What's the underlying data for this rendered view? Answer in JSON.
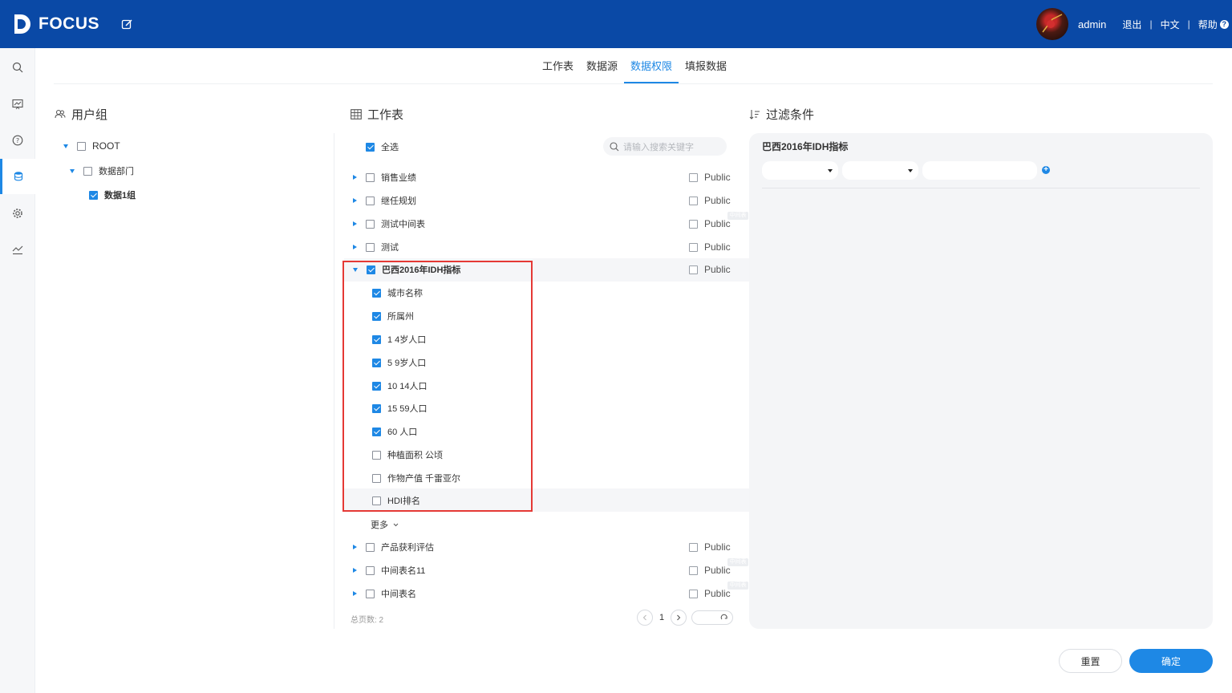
{
  "app": {
    "logo_text": "FOCUS"
  },
  "header": {
    "user": "admin",
    "logout": "退出",
    "language": "中文",
    "help": "帮助"
  },
  "tabs": [
    {
      "label": "工作表",
      "active": false
    },
    {
      "label": "数据源",
      "active": false
    },
    {
      "label": "数据权限",
      "active": true
    },
    {
      "label": "填报数据",
      "active": false
    }
  ],
  "usergroup": {
    "title": "用户组",
    "root": {
      "label": "ROOT",
      "checked": false
    },
    "dept": {
      "label": "数据部门",
      "checked": false
    },
    "group": {
      "label": "数据1组",
      "checked": true
    }
  },
  "worksheet": {
    "title": "工作表",
    "select_all": {
      "label": "全选",
      "checked": true
    },
    "search_placeholder": "请输入搜索关键字",
    "sheets_top": [
      {
        "label": "销售业绩",
        "checked": false,
        "public": "Public",
        "tag": ""
      },
      {
        "label": "继任规划",
        "checked": false,
        "public": "Public",
        "tag": ""
      },
      {
        "label": "测试中间表",
        "checked": false,
        "public": "Public",
        "tag": "中间表"
      },
      {
        "label": "测试",
        "checked": false,
        "public": "Public",
        "tag": ""
      }
    ],
    "expanded": {
      "label": "巴西2016年IDH指标",
      "checked": true,
      "public": "Public",
      "fields": [
        {
          "label": "城市名称",
          "checked": true
        },
        {
          "label": "所属州",
          "checked": true
        },
        {
          "label": "1 4岁人口",
          "checked": true
        },
        {
          "label": "5 9岁人口",
          "checked": true
        },
        {
          "label": "10 14人口",
          "checked": true
        },
        {
          "label": "15 59人口",
          "checked": true
        },
        {
          "label": "60 人口",
          "checked": true
        },
        {
          "label": "种植面积 公顷",
          "checked": false
        },
        {
          "label": "作物产值 千雷亚尔",
          "checked": false
        },
        {
          "label": "HDI排名",
          "checked": false
        }
      ]
    },
    "more": "更多",
    "sheets_bottom": [
      {
        "label": "产品获利评估",
        "checked": false,
        "public": "Public",
        "tag": ""
      },
      {
        "label": "中间表名11",
        "checked": false,
        "public": "Public",
        "tag": "中间表"
      },
      {
        "label": "中间表名",
        "checked": false,
        "public": "Public",
        "tag": "中间表"
      }
    ],
    "total_pages": "总页数: 2",
    "current_page": "1"
  },
  "filter": {
    "title": "过滤条件",
    "sheet_name": "巴西2016年IDH指标"
  },
  "buttons": {
    "reset": "重置",
    "confirm": "确定"
  },
  "colors": {
    "header_bg": "#0a49a6",
    "accent": "#1e88e5",
    "highlight_border": "#e53935"
  }
}
